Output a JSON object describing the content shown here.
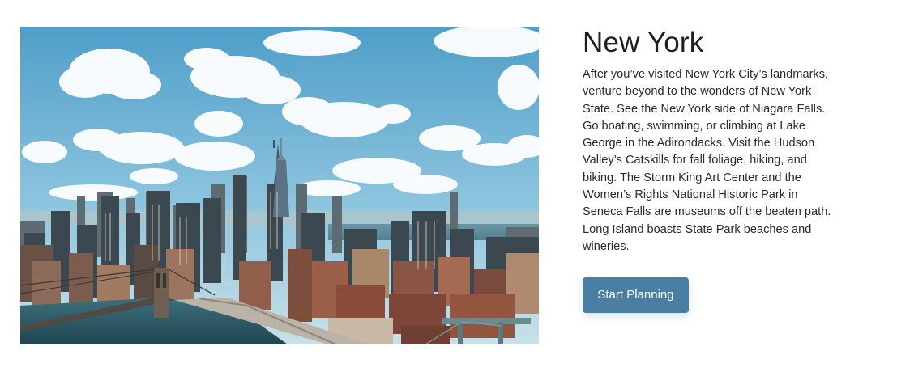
{
  "hero": {
    "image_alt": "Aerial view of the New York City skyline, Brooklyn Bridge and East River under a blue sky with white clouds"
  },
  "destination": {
    "title": "New York",
    "description": "After you’ve visited New York City’s landmarks, venture beyond to the wonders of New York State. See the New York side of Niagara Falls. Go boating, swimming, or climbing at Lake George in the Adirondacks. Visit the Hudson Valley’s Catskills for fall foliage, hiking, and biking. The Storm King Art Center and the Women’s Rights National Historic Park in Seneca Falls are museums off the beaten path. Long Island boasts State Park beaches and wineries.",
    "cta_label": "Start Planning"
  },
  "colors": {
    "button_bg": "#4a7fa3",
    "button_text": "#ffffff",
    "title_text": "#1f1f1f",
    "body_text": "#2a2a2a"
  }
}
